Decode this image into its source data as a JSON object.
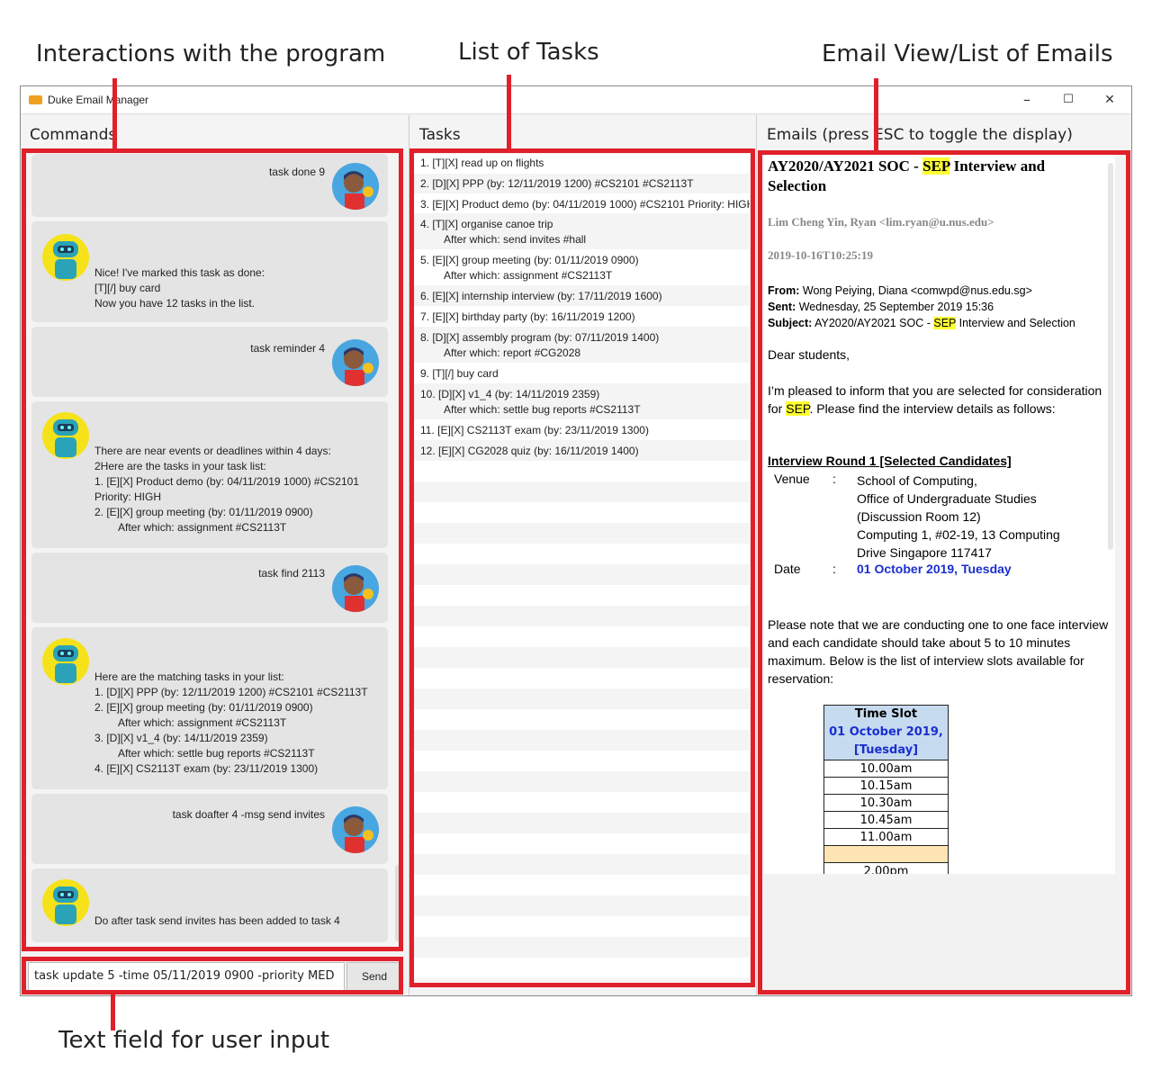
{
  "annotations": {
    "interactions": "Interactions with the program",
    "tasks": "List of Tasks",
    "email": "Email View/List of Emails",
    "textfield": "Text field for user input"
  },
  "window": {
    "title": "Duke Email Manager",
    "minimize": "–",
    "maximize": "☐",
    "close": "✕"
  },
  "headers": {
    "commands": "Commands",
    "tasks": "Tasks",
    "emails": "Emails (press ESC to toggle the display)"
  },
  "chat": [
    {
      "role": "user",
      "text": "task done 9"
    },
    {
      "role": "bot",
      "text": "Nice! I've marked this task as done:\n[T][/] buy card\nNow you have 12 tasks in the list."
    },
    {
      "role": "user",
      "text": "task reminder 4"
    },
    {
      "role": "bot",
      "text": "There are near events or deadlines within 4 days:\n2Here are the tasks in your task list:\n1. [E][X] Product demo (by: 04/11/2019 1000) #CS2101\nPriority: HIGH\n2. [E][X] group meeting (by: 01/11/2019 0900)\n        After which: assignment #CS2113T"
    },
    {
      "role": "user",
      "text": "task find 2113"
    },
    {
      "role": "bot",
      "text": "Here are the matching tasks in your list:\n1. [D][X] PPP (by: 12/11/2019 1200) #CS2101 #CS2113T\n2. [E][X] group meeting (by: 01/11/2019 0900)\n        After which: assignment #CS2113T\n3. [D][X] v1_4 (by: 14/11/2019 2359)\n        After which: settle bug reports #CS2113T\n4. [E][X] CS2113T exam (by: 23/11/2019 1300)"
    },
    {
      "role": "user",
      "text": "task doafter 4 -msg send invites"
    },
    {
      "role": "bot",
      "text": "Do after task send invites has been added to task 4"
    }
  ],
  "input": {
    "value": "task update 5 -time 05/11/2019 0900 -priority MED",
    "send_label": "Send"
  },
  "tasks": [
    {
      "main": "1. [T][X] read up on flights",
      "sub": ""
    },
    {
      "main": "2. [D][X] PPP (by: 12/11/2019 1200) #CS2101 #CS2113T",
      "sub": ""
    },
    {
      "main": "3. [E][X] Product demo (by: 04/11/2019 1000) #CS2101 Priority: HIGH",
      "sub": ""
    },
    {
      "main": "4. [T][X] organise canoe trip",
      "sub": "After which: send invites #hall"
    },
    {
      "main": "5. [E][X] group meeting (by: 01/11/2019 0900)",
      "sub": "After which: assignment #CS2113T"
    },
    {
      "main": "6. [E][X] internship interview (by: 17/11/2019 1600)",
      "sub": ""
    },
    {
      "main": "7. [E][X] birthday party (by: 16/11/2019 1200)",
      "sub": ""
    },
    {
      "main": "8. [D][X] assembly program (by: 07/11/2019 1400)",
      "sub": "After which: report #CG2028"
    },
    {
      "main": "9. [T][/] buy card",
      "sub": ""
    },
    {
      "main": "10. [D][X] v1_4 (by: 14/11/2019 2359)",
      "sub": "After which: settle bug reports #CS2113T"
    },
    {
      "main": "11. [E][X] CS2113T exam (by: 23/11/2019 1300)",
      "sub": ""
    },
    {
      "main": "12. [E][X] CG2028 quiz (by: 16/11/2019 1400)",
      "sub": ""
    }
  ],
  "email": {
    "subject_pre": "AY2020/AY2021 SOC - ",
    "subject_hl": "SEP",
    "subject_post": " Interview and Selection",
    "sender": "Lim Cheng Yin, Ryan <lim.ryan@u.nus.edu>",
    "datetime": "2019-10-16T10:25:19",
    "from_label": "From:",
    "from_value": " Wong Peiying, Diana <comwpd@nus.edu.sg>",
    "sent_label": "Sent:",
    "sent_value": " Wednesday, 25 September 2019 15:36",
    "subj_label": "Subject:",
    "subj_pre": " AY2020/AY2021 SOC - ",
    "subj_hl": "SEP",
    "subj_post": " Interview and Selection",
    "greeting": "Dear students,",
    "p1_pre": "I’m pleased to inform that you are selected for consideration for ",
    "p1_hl": "SEP",
    "p1_post": ". Please find the interview details as follows:",
    "round_title": "Interview Round 1 [Selected Candidates]",
    "venue_label": "Venue",
    "colon": ":",
    "venue_lines": [
      "School of Computing,",
      "Office of Undergraduate Studies",
      "(Discussion Room 12)",
      "Computing 1, #02-19, 13 Computing",
      "Drive  Singapore 117417"
    ],
    "date_label": "Date",
    "date_value": "01 October 2019, Tuesday",
    "p2": "Please note that we are conducting one to one face interview and each candidate should take about 5 to 10 minutes maximum. Below is the list of interview slots available for reservation:",
    "slot_header": "Time Slot",
    "slot_date": "01 October 2019, [Tuesday]",
    "slots": [
      "10.00am",
      "10.15am",
      "10.30am",
      "10.45am",
      "11.00am"
    ],
    "slot_partial": "2.00pm"
  },
  "colors": {
    "accent_red": "#e0202a",
    "highlight": "#ffff33",
    "link_blue": "#1a2fd0",
    "slot_header_bg": "#c6dbef",
    "slot_break_bg": "#fde4b2"
  }
}
